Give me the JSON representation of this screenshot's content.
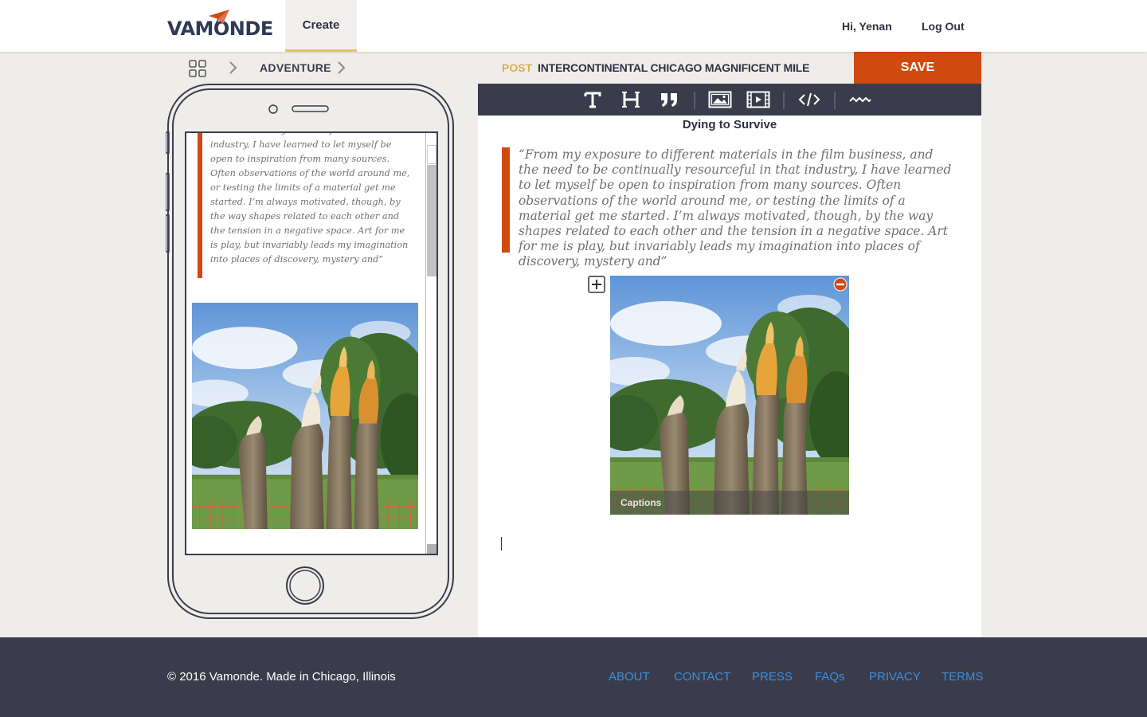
{
  "header": {
    "logo_text": "VAMONDE",
    "nav_create": "Create",
    "greeting": "Hi, Yenan",
    "logout": "Log Out"
  },
  "breadcrumb": {
    "category": "ADVENTURE"
  },
  "post_bar": {
    "label": "POST",
    "title": "INTERCONTINENTAL CHICAGO MAGNIFICENT MILE",
    "save": "SAVE"
  },
  "toolbar": {
    "icons": [
      "text-icon",
      "heading-icon",
      "quote-icon",
      "image-icon",
      "video-icon",
      "code-icon",
      "divider-icon"
    ]
  },
  "editor": {
    "title": "Dying to Survive",
    "quote": "“From my exposure to different materials in the film business, and the need to be continually resourceful in that industry, I have learned to let myself be open to inspiration from many sources. Often observations of the world around me, or testing the limits of a material get me started. I’m always motivated, though, by the way shapes related to each other and the tension in a negative space. Art for me is play, but invariably leads my imagination into places of discovery, mystery and”",
    "caption_placeholder": "Captions"
  },
  "phone_preview": {
    "quote": "to be continually resourceful in that industry, I have learned to let myself be open to inspiration from many sources. Often observations of the world around me, or testing the limits of a material get me started. I’m always motivated, though, by the way shapes related to each other and the tension in a negative space. Art for me is play, but invariably leads my imagination into places of discovery, mystery and”"
  },
  "footer": {
    "copyright": "© 2016 Vamonde. Made in Chicago, Illinois",
    "links": [
      "ABOUT",
      "CONTACT",
      "PRESS",
      "FAQs",
      "PRIVACY",
      "TERMS"
    ]
  },
  "colors": {
    "accent": "#cf4a0e",
    "gold": "#d8b050",
    "dark": "#3a3c4b",
    "link": "#3a8fdc"
  }
}
